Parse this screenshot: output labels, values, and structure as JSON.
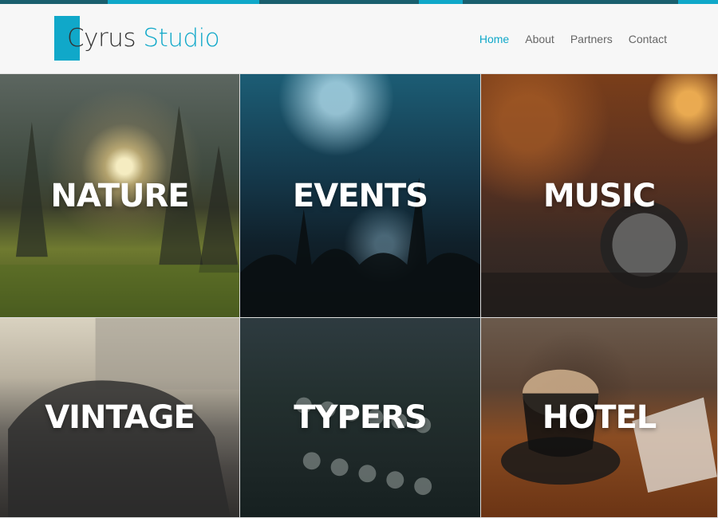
{
  "header": {
    "logo_first": "Cyrus",
    "logo_second": "Studio",
    "brand_color": "#10a8c9"
  },
  "nav": {
    "items": [
      {
        "label": "Home",
        "active": true
      },
      {
        "label": "About",
        "active": false
      },
      {
        "label": "Partners",
        "active": false
      },
      {
        "label": "Contact",
        "active": false
      }
    ]
  },
  "tiles": [
    {
      "label": "NATURE"
    },
    {
      "label": "EVENTS"
    },
    {
      "label": "MUSIC"
    },
    {
      "label": "VINTAGE"
    },
    {
      "label": "TYPERS"
    },
    {
      "label": "HOTEL"
    }
  ]
}
